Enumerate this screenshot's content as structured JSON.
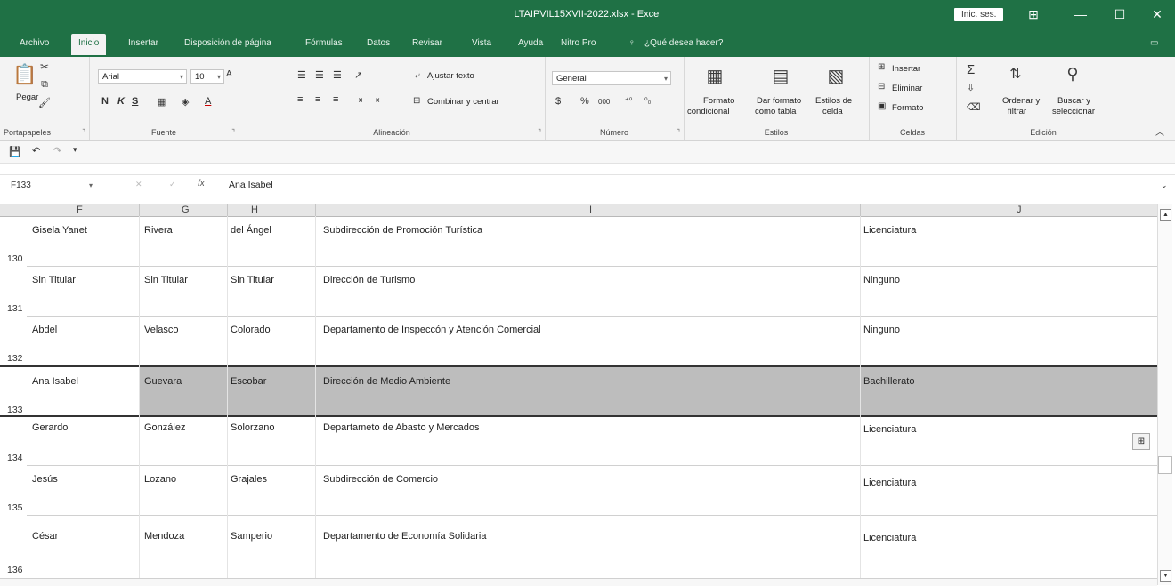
{
  "window": {
    "title": "LTAIPVIL15XVII-2022.xlsx  -  Excel",
    "signin": "Inic. ses.",
    "controls": {
      "ribbon_display": "⊞",
      "minimize": "—",
      "maximize": "☐",
      "close": "✕"
    }
  },
  "tabs": [
    {
      "label": "Archivo"
    },
    {
      "label": "Inicio"
    },
    {
      "label": "Insertar"
    },
    {
      "label": "Disposición de página"
    },
    {
      "label": "Fórmulas"
    },
    {
      "label": "Datos"
    },
    {
      "label": "Revisar"
    },
    {
      "label": "Vista"
    },
    {
      "label": "Ayuda"
    },
    {
      "label": "Nitro Pro"
    },
    {
      "label": "¿Qué desea hacer?"
    }
  ],
  "ribbon": {
    "clipboard": {
      "paste": "Pegar",
      "group": "Portapapeles"
    },
    "font": {
      "name": "Arial",
      "size": "10",
      "bold": "N",
      "italic": "K",
      "underline": "S",
      "group": "Fuente"
    },
    "alignment": {
      "wrap": "Ajustar texto",
      "merge": "Combinar y centrar",
      "group": "Alineación"
    },
    "number": {
      "format": "General",
      "currency": "$",
      "percent": "%",
      "thousands": "000",
      "group": "Número"
    },
    "styles": {
      "conditional_1": "Formato",
      "conditional_2": "condicional",
      "table_1": "Dar formato",
      "table_2": "como tabla",
      "cell_1": "Estilos de",
      "cell_2": "celda",
      "group": "Estilos"
    },
    "cells": {
      "insert": "Insertar",
      "delete": "Eliminar",
      "format": "Formato",
      "group": "Celdas"
    },
    "editing": {
      "sort_1": "Ordenar y",
      "sort_2": "filtrar",
      "find_1": "Buscar y",
      "find_2": "seleccionar",
      "group": "Edición"
    }
  },
  "formula_bar": {
    "name_box": "F133",
    "fx": "fx",
    "value": "Ana Isabel"
  },
  "columns": [
    "F",
    "G",
    "H",
    "I",
    "J"
  ],
  "rows": [
    {
      "num": "130",
      "selected": false,
      "cells": [
        "Gisela Yanet",
        "Rivera",
        "del Ángel",
        "Subdirección de Promoción Turística",
        "Licenciatura"
      ]
    },
    {
      "num": "131",
      "selected": false,
      "cells": [
        "Sin Titular",
        "Sin Titular",
        "Sin Titular",
        "Dirección de Turismo",
        "Ninguno"
      ]
    },
    {
      "num": "132",
      "selected": false,
      "cells": [
        "Abdel",
        "Velasco",
        "Colorado",
        "Departamento de Inspeccón y Atención Comercial",
        "Ninguno"
      ]
    },
    {
      "num": "133",
      "selected": true,
      "cells": [
        "Ana Isabel",
        "Guevara",
        "Escobar",
        "Dirección de Medio Ambiente",
        "Bachillerato"
      ]
    },
    {
      "num": "134",
      "selected": false,
      "cells": [
        "Gerardo",
        "González",
        "Solorzano",
        "Departameto de Abasto y Mercados",
        "Licenciatura"
      ]
    },
    {
      "num": "135",
      "selected": false,
      "cells": [
        "Jesús",
        "Lozano",
        "Grajales",
        "Subdirección de Comercio",
        "Licenciatura"
      ]
    },
    {
      "num": "136",
      "selected": false,
      "cells": [
        "César",
        "Mendoza",
        "Samperio",
        "Departamento de Economía Solidaria",
        "Licenciatura"
      ]
    }
  ],
  "colors": {
    "excel_green": "#1f7145",
    "selection_gray": "#bdbdbd"
  }
}
